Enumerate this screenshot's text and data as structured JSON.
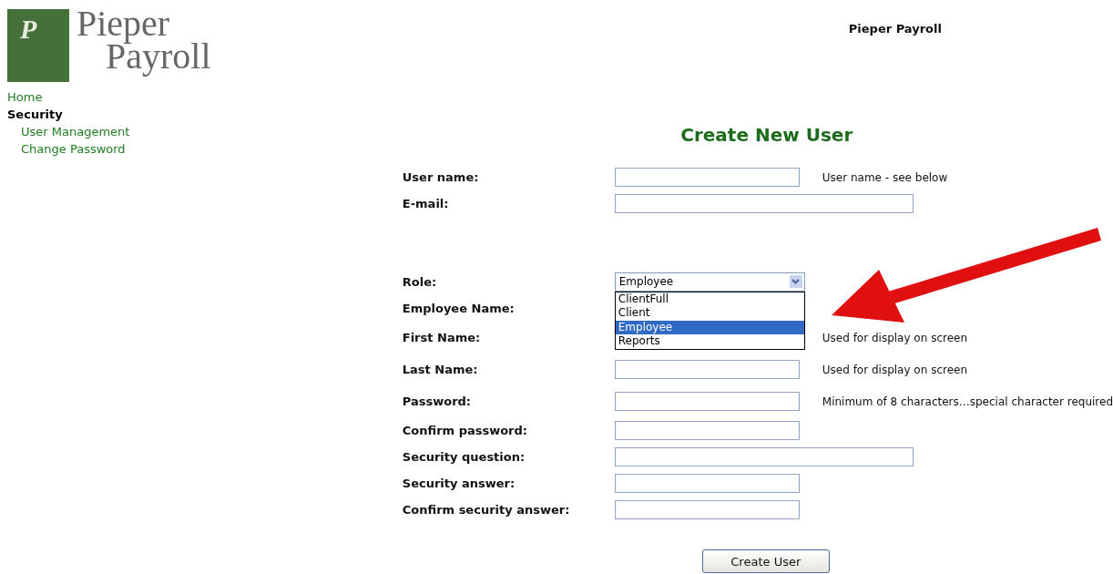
{
  "logo": {
    "letter": "P",
    "lines": [
      "Pieper",
      "Payroll"
    ]
  },
  "site_title": "Pieper Payroll",
  "nav": [
    {
      "label": "Home",
      "kind": "link"
    },
    {
      "label": "Security",
      "kind": "section",
      "children": [
        {
          "label": "User Management",
          "kind": "link"
        },
        {
          "label": "Change Password",
          "kind": "link"
        }
      ]
    }
  ],
  "form": {
    "title": "Create New User",
    "rows": [
      {
        "label": "User name:",
        "kind": "text",
        "hint": "User name - see below"
      },
      {
        "label": "E-mail:",
        "kind": "wide"
      },
      {
        "label": "Role:",
        "kind": "select",
        "value": "Employee",
        "expanded": true,
        "options": [
          {
            "label": "ClientFull",
            "selected": false
          },
          {
            "label": "Client",
            "selected": false
          },
          {
            "label": "Employee",
            "selected": true
          },
          {
            "label": "Reports",
            "selected": false
          }
        ]
      },
      {
        "label": "Employee Name:",
        "kind": "hidden"
      },
      {
        "label": "First Name:",
        "kind": "hidden",
        "hint": "Used for display on screen"
      },
      {
        "label": "Last Name:",
        "kind": "text",
        "hint": "Used for display on screen"
      },
      {
        "label": "Password:",
        "kind": "text",
        "hint": "Minimum of 8 characters…special character required"
      },
      {
        "label": "Confirm password:",
        "kind": "text"
      },
      {
        "label": "Security question:",
        "kind": "wide"
      },
      {
        "label": "Security answer:",
        "kind": "text"
      },
      {
        "label": "Confirm security answer:",
        "kind": "text"
      }
    ],
    "submit": "Create User"
  }
}
